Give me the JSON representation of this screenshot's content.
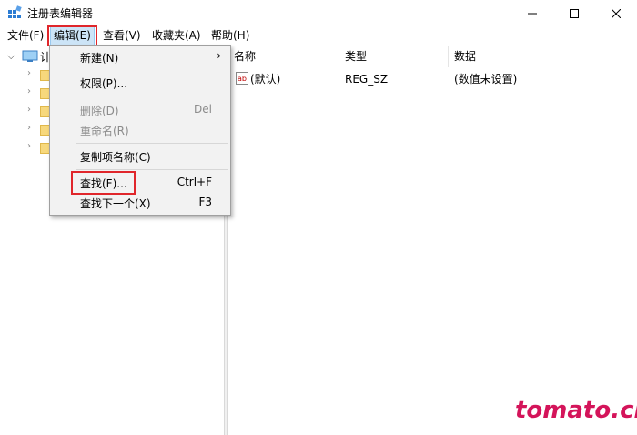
{
  "window": {
    "title": "注册表编辑器",
    "app_icon": "regedit-icon"
  },
  "menubar": {
    "items": [
      {
        "label": "文件(F)"
      },
      {
        "label": "编辑(E)"
      },
      {
        "label": "查看(V)"
      },
      {
        "label": "收藏夹(A)"
      },
      {
        "label": "帮助(H)"
      }
    ],
    "active_index": 1
  },
  "tree": {
    "root_label": "计",
    "root_icon": "computer-icon",
    "child_icon": "folder-icon"
  },
  "list": {
    "columns": [
      "名称",
      "类型",
      "数据"
    ],
    "rows": [
      {
        "name": "(默认)",
        "type": "REG_SZ",
        "data": "(数值未设置)",
        "icon": "string-value-icon"
      }
    ]
  },
  "edit_menu": {
    "items": [
      {
        "label": "新建(N)",
        "submenu": true
      },
      {
        "label": "权限(P)..."
      },
      {
        "label": "删除(D)",
        "shortcut": "Del",
        "disabled": true
      },
      {
        "label": "重命名(R)",
        "disabled": true
      },
      {
        "label": "复制项名称(C)"
      },
      {
        "label": "查找(F)...",
        "shortcut": "Ctrl+F",
        "highlighted": true
      },
      {
        "label": "查找下一个(X)",
        "shortcut": "F3"
      }
    ]
  },
  "watermark": "tomato.cm",
  "colors": {
    "highlight_box": "#e0262b",
    "watermark": "#d4145a",
    "menu_active_bg": "#cce4f7"
  }
}
